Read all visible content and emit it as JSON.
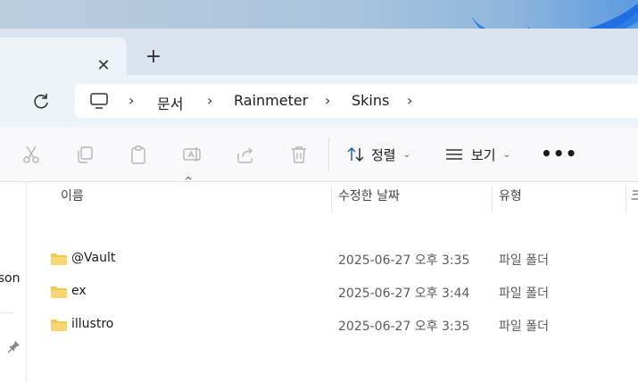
{
  "tabs": {
    "close_glyph": "✕",
    "new_tab_glyph": "+"
  },
  "breadcrumb": {
    "items": [
      "문서",
      "Rainmeter",
      "Skins"
    ],
    "separator": "›"
  },
  "toolbar": {
    "icons": [
      "cut-icon",
      "copy-icon",
      "paste-icon",
      "rename-icon",
      "share-icon",
      "delete-icon"
    ],
    "sort_label": "정렬",
    "view_label": "보기",
    "more_label": "•••",
    "dropdown_glyph": "⌄"
  },
  "nav": {
    "partial_label": "rson"
  },
  "columns": {
    "name": "이름",
    "modified": "수정한 날짜",
    "type": "유형",
    "size_partial": "크"
  },
  "sort_caret": "^",
  "files": [
    {
      "name": "@Vault",
      "modified": "2025-06-27 오후 3:35",
      "type": "파일 폴더"
    },
    {
      "name": "ex",
      "modified": "2025-06-27 오후 3:44",
      "type": "파일 폴더"
    },
    {
      "name": "illustro",
      "modified": "2025-06-27 오후 3:35",
      "type": "파일 폴더"
    }
  ],
  "colors": {
    "folder": "#f2c94c",
    "accent": "#2f7ee6"
  }
}
